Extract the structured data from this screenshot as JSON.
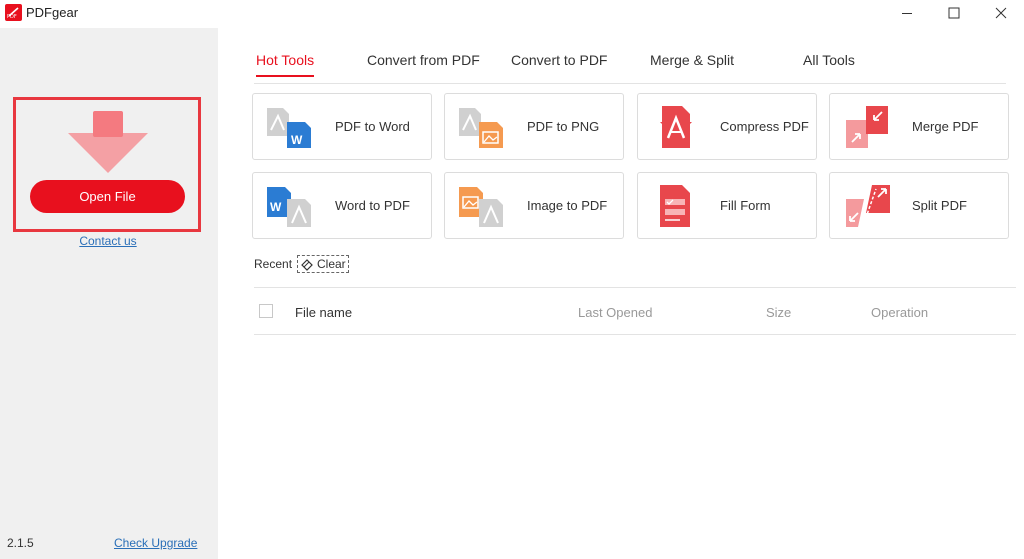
{
  "app": {
    "title": "PDFgear"
  },
  "window_controls": {
    "minimize": "minimize",
    "maximize": "maximize",
    "close": "close"
  },
  "sidebar": {
    "open_file_label": "Open File",
    "contact_label": "Contact us",
    "version": "2.1.5",
    "upgrade_label": "Check Upgrade"
  },
  "tabs": [
    {
      "label": "Hot Tools",
      "active": true
    },
    {
      "label": "Convert from PDF",
      "active": false
    },
    {
      "label": "Convert to PDF",
      "active": false
    },
    {
      "label": "Merge & Split",
      "active": false
    },
    {
      "label": "All Tools",
      "active": false
    }
  ],
  "tools": [
    {
      "label": "PDF to Word",
      "icon": "pdf-to-word-icon"
    },
    {
      "label": "PDF to PNG",
      "icon": "pdf-to-png-icon"
    },
    {
      "label": "Compress PDF",
      "icon": "compress-pdf-icon"
    },
    {
      "label": "Merge PDF",
      "icon": "merge-pdf-icon"
    },
    {
      "label": "Word to PDF",
      "icon": "word-to-pdf-icon"
    },
    {
      "label": "Image to PDF",
      "icon": "image-to-pdf-icon"
    },
    {
      "label": "Fill Form",
      "icon": "fill-form-icon"
    },
    {
      "label": "Split PDF",
      "icon": "split-pdf-icon"
    }
  ],
  "recent": {
    "label": "Recent",
    "clear_label": "Clear",
    "columns": {
      "file_name": "File name",
      "last_opened": "Last Opened",
      "size": "Size",
      "operation": "Operation"
    },
    "rows": []
  },
  "colors": {
    "accent": "#e8101e",
    "highlight": "#e8373f",
    "link": "#2a6fb8",
    "sidebar_bg": "#f0f0f0"
  }
}
